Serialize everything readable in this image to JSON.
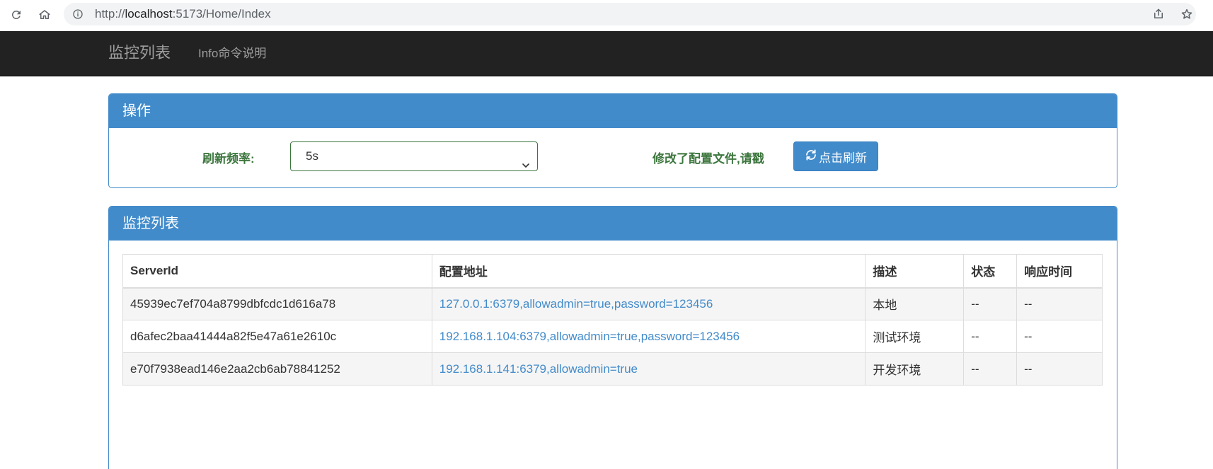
{
  "browser": {
    "url_scheme": "http://",
    "url_host": "localhost",
    "url_rest": ":5173/Home/Index",
    "icons": [
      "reload-icon",
      "home-icon",
      "info-icon",
      "share-icon",
      "star-icon"
    ]
  },
  "navbar": {
    "brand": "监控列表",
    "link": "Info命令说明"
  },
  "operations": {
    "title": "操作",
    "refresh_label": "刷新频率:",
    "refresh_value": "5s",
    "message": "修改了配置文件,请戳",
    "refresh_button": "点击刷新"
  },
  "monitor": {
    "title": "监控列表",
    "columns": [
      "ServerId",
      "配置地址",
      "描述",
      "状态",
      "响应时间"
    ],
    "rows": [
      [
        "45939ec7ef704a8799dbfcdc1d616a78",
        "127.0.0.1:6379,allowadmin=true,password=123456",
        "本地",
        "--",
        "--"
      ],
      [
        "d6afec2baa41444a82f5e47a61e2610c",
        "192.168.1.104:6379,allowadmin=true,password=123456",
        "测试环境",
        "--",
        "--"
      ],
      [
        "e70f7938ead146e2aa2cb6ab78841252",
        "192.168.1.141:6379,allowadmin=true",
        "开发环境",
        "--",
        "--"
      ]
    ]
  },
  "colors": {
    "primary": "#428bca",
    "navbar": "#222222",
    "success_text": "#3c763d"
  }
}
